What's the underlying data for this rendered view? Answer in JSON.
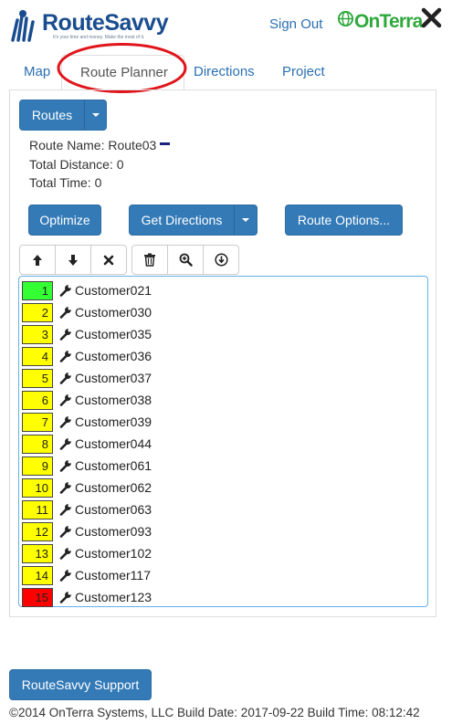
{
  "header": {
    "brand": "RouteSavvy",
    "tagline": "It's your time and money. Make the most of it.",
    "sign_out": "Sign Out",
    "partner": "OnTerra"
  },
  "tabs": [
    {
      "label": "Map",
      "active": false
    },
    {
      "label": "Route Planner",
      "active": true
    },
    {
      "label": "Directions",
      "active": false
    },
    {
      "label": "Project",
      "active": false
    }
  ],
  "routes_button": "Routes",
  "route_info": {
    "name_label": "Route Name:",
    "name_value": "Route03",
    "route_color": "#1a237e",
    "distance_label": "Total Distance:",
    "distance_value": "0",
    "time_label": "Total Time:",
    "time_value": "0"
  },
  "actions": {
    "optimize": "Optimize",
    "get_directions": "Get Directions",
    "route_options": "Route Options..."
  },
  "toolbar": [
    "arrow-up-icon",
    "arrow-down-icon",
    "remove-icon",
    "trash-icon",
    "zoom-in-icon",
    "download-icon"
  ],
  "stops": [
    {
      "num": "1",
      "name": "Customer021",
      "color": "#33ff33"
    },
    {
      "num": "2",
      "name": "Customer030",
      "color": "#ffff00"
    },
    {
      "num": "3",
      "name": "Customer035",
      "color": "#ffff00"
    },
    {
      "num": "4",
      "name": "Customer036",
      "color": "#ffff00"
    },
    {
      "num": "5",
      "name": "Customer037",
      "color": "#ffff00"
    },
    {
      "num": "6",
      "name": "Customer038",
      "color": "#ffff00"
    },
    {
      "num": "7",
      "name": "Customer039",
      "color": "#ffff00"
    },
    {
      "num": "8",
      "name": "Customer044",
      "color": "#ffff00"
    },
    {
      "num": "9",
      "name": "Customer061",
      "color": "#ffff00"
    },
    {
      "num": "10",
      "name": "Customer062",
      "color": "#ffff00"
    },
    {
      "num": "11",
      "name": "Customer063",
      "color": "#ffff00"
    },
    {
      "num": "12",
      "name": "Customer093",
      "color": "#ffff00"
    },
    {
      "num": "13",
      "name": "Customer102",
      "color": "#ffff00"
    },
    {
      "num": "14",
      "name": "Customer117",
      "color": "#ffff00"
    },
    {
      "num": "15",
      "name": "Customer123",
      "color": "#ff0000"
    }
  ],
  "support_button": "RouteSavvy Support",
  "footer": "©2014 OnTerra Systems, LLC Build Date: 2017-09-22 Build Time: 08:12:42"
}
